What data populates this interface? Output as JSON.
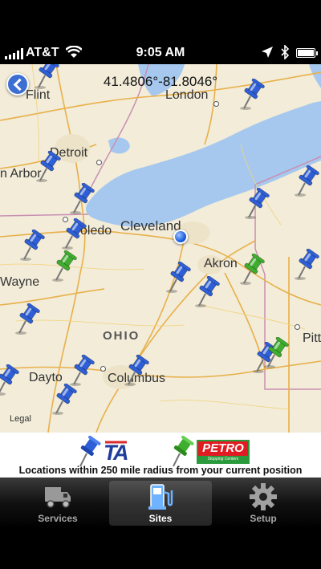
{
  "status_bar": {
    "carrier": "AT&T",
    "time": "9:05 AM"
  },
  "map": {
    "coordinates": "41.4806°-81.8046°",
    "cities": [
      {
        "id": "flint",
        "label": "Flint"
      },
      {
        "id": "london",
        "label": "London"
      },
      {
        "id": "detroit",
        "label": "Detroit"
      },
      {
        "id": "ann-arbor",
        "label": "n Arbor"
      },
      {
        "id": "toledo",
        "label": "oledo"
      },
      {
        "id": "cleveland",
        "label": "Cleveland"
      },
      {
        "id": "akron",
        "label": "Akron"
      },
      {
        "id": "wayne",
        "label": "Wayne"
      },
      {
        "id": "ohio",
        "label": "OHIO"
      },
      {
        "id": "pittsburgh",
        "label": "Pitt"
      },
      {
        "id": "dayton",
        "label": "Dayto"
      },
      {
        "id": "columbus",
        "label": "Columbus"
      }
    ],
    "legal": "Legal",
    "pin_colors": {
      "ta": "#2f5fd6",
      "petro": "#3fae2f"
    }
  },
  "legend": {
    "ta_label": "TA",
    "petro_label": "PETRO",
    "petro_sub": "Stopping Centers",
    "caption": "Locations within 250 mile radius from your current position"
  },
  "tabs": [
    {
      "label": "Services",
      "icon": "truck-icon",
      "active": false
    },
    {
      "label": "Sites",
      "icon": "fuel-pump-icon",
      "active": true
    },
    {
      "label": "Setup",
      "icon": "gear-icon",
      "active": false
    }
  ]
}
